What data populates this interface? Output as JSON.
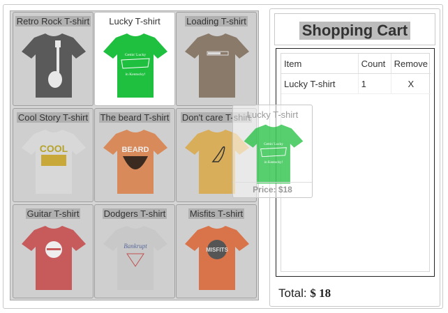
{
  "products": [
    {
      "name": "Retro Rock T-shirt",
      "shirt_color": "#5a5a5a",
      "art": "guitar-art"
    },
    {
      "name": "Lucky T-shirt",
      "shirt_color": "#1fbf3f",
      "art": "kentucky-art",
      "art_text_top": "Gettin' Lucky",
      "art_text_bottom": "in Kentucky!"
    },
    {
      "name": "Loading T-shirt",
      "shirt_color": "#8a7a6a",
      "art": "loading-bar-art"
    },
    {
      "name": "Cool Story T-shirt",
      "shirt_color": "#d8d8d8",
      "art": "cool-story-art",
      "art_text": "COOL"
    },
    {
      "name": "The beard T-shirt",
      "shirt_color": "#d98a5a",
      "art": "beard-art",
      "art_text": "BEARD"
    },
    {
      "name": "Don't care T-shirt",
      "shirt_color": "#d8ae5a",
      "art": "skunk-art"
    },
    {
      "name": "Guitar T-shirt",
      "shirt_color": "#c75a5a",
      "art": "guitar-circle-art"
    },
    {
      "name": "Dodgers T-shirt",
      "shirt_color": "#c8c8c8",
      "art": "dodgers-art",
      "art_text": "Bankrupt"
    },
    {
      "name": "Misfits T-shirt",
      "shirt_color": "#d9744a",
      "art": "misfits-art",
      "art_text": "MISFITS"
    }
  ],
  "dragging": {
    "name": "Lucky T-shirt",
    "price": "Price: $18",
    "shirt_color": "#1fbf3f"
  },
  "cart": {
    "title": "Shopping Cart",
    "headers": [
      "Item",
      "Count",
      "Remove"
    ],
    "rows": [
      {
        "item": "Lucky T-shirt",
        "count": "1",
        "remove": "X"
      }
    ],
    "total_label": "Total:",
    "total_value": "$ 18"
  }
}
